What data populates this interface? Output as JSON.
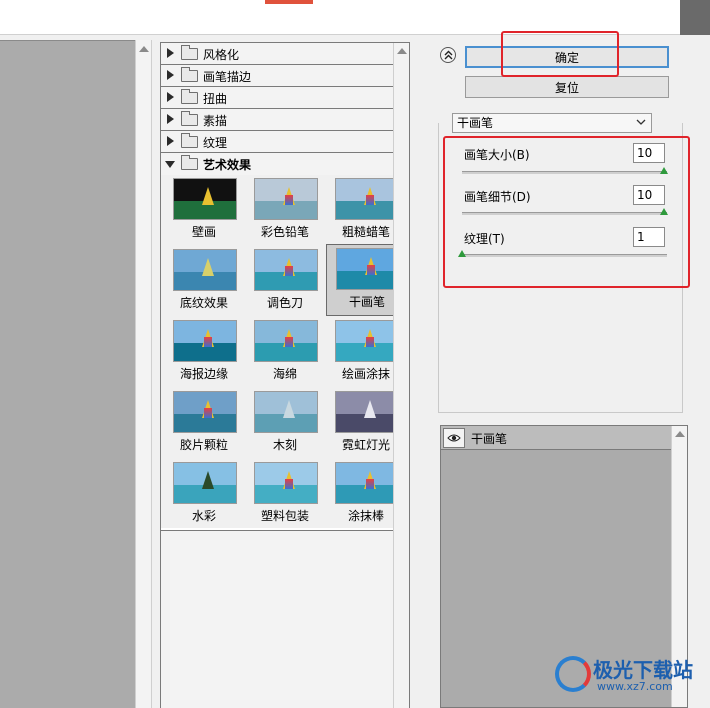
{
  "dialog": {
    "ok_label": "确定",
    "reset_label": "复位"
  },
  "categories": [
    {
      "label": "风格化"
    },
    {
      "label": "画笔描边"
    },
    {
      "label": "扭曲"
    },
    {
      "label": "素描"
    },
    {
      "label": "纹理"
    },
    {
      "label": "艺术效果"
    }
  ],
  "thumbnails": [
    {
      "label": "壁画"
    },
    {
      "label": "彩色铅笔"
    },
    {
      "label": "粗糙蜡笔"
    },
    {
      "label": "底纹效果"
    },
    {
      "label": "调色刀"
    },
    {
      "label": "干画笔"
    },
    {
      "label": "海报边缘"
    },
    {
      "label": "海绵"
    },
    {
      "label": "绘画涂抹"
    },
    {
      "label": "胶片颗粒"
    },
    {
      "label": "木刻"
    },
    {
      "label": "霓虹灯光"
    },
    {
      "label": "水彩"
    },
    {
      "label": "塑料包装"
    },
    {
      "label": "涂抹棒"
    }
  ],
  "filter": {
    "selected": "干画笔",
    "params": [
      {
        "label": "画笔大小(B)",
        "value": "10",
        "slider_fraction": 1.0
      },
      {
        "label": "画笔细节(D)",
        "value": "10",
        "slider_fraction": 1.0
      },
      {
        "label": "纹理(T)",
        "value": "1",
        "slider_fraction": 0.0
      }
    ]
  },
  "layers": [
    {
      "name": "干画笔"
    }
  ],
  "watermark": {
    "brand": "极光下载站",
    "url": "www.xz7.com"
  },
  "colors": {
    "accent_red": "#e0242b",
    "ok_border": "#4a90d0",
    "slider_green": "#2e9a3c",
    "panel_gray": "#ababab"
  }
}
